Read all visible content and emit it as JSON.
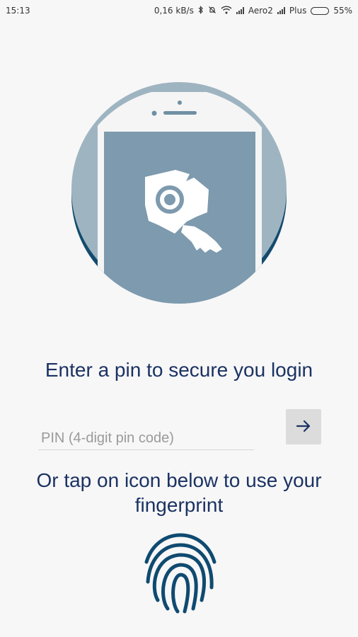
{
  "status_bar": {
    "time": "15:13",
    "net_speed": "0,16 kB/s",
    "carrier1": "Aero2",
    "carrier2": "Plus",
    "battery": "55%",
    "icons": [
      "bluetooth-icon",
      "alarm-off-icon",
      "wifi-icon",
      "signal-icon",
      "signal-icon",
      "battery-icon"
    ]
  },
  "hero": {
    "icon": "phone-key-illustration",
    "colors": {
      "circle_light": "#9fb4c1",
      "circle_dark": "#134b6e",
      "screen": "#7d9aae",
      "phone_frame": "#f5f5f5"
    }
  },
  "pin": {
    "title": "Enter a pin to secure you login",
    "placeholder": "PIN (4-digit pin code)",
    "value": "",
    "submit_icon": "arrow-right-icon"
  },
  "fingerprint": {
    "title": "Or tap on icon below to use your fingerprint",
    "icon": "fingerprint-icon",
    "color": "#0f4a70"
  }
}
